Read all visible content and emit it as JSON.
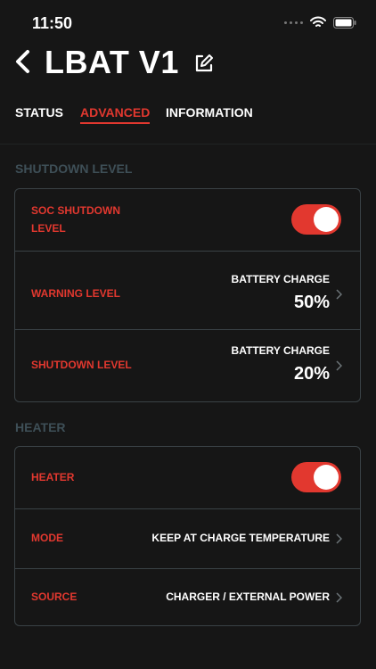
{
  "status_bar": {
    "time": "11:50"
  },
  "header": {
    "title": "LBAT V1"
  },
  "tabs": [
    {
      "label": "STATUS",
      "active": false
    },
    {
      "label": "ADVANCED",
      "active": true
    },
    {
      "label": "INFORMATION",
      "active": false
    }
  ],
  "shutdown": {
    "section_title": "SHUTDOWN LEVEL",
    "soc": {
      "label_line1": "SOC SHUTDOWN",
      "label_line2": "LEVEL",
      "enabled": true
    },
    "warning": {
      "label": "WARNING LEVEL",
      "caption": "BATTERY CHARGE",
      "value": "50%"
    },
    "shutdown_level": {
      "label": "SHUTDOWN LEVEL",
      "caption": "BATTERY CHARGE",
      "value": "20%"
    }
  },
  "heater": {
    "section_title": "HEATER",
    "heater_toggle": {
      "label": "HEATER",
      "enabled": true
    },
    "mode": {
      "label": "MODE",
      "value": "KEEP AT CHARGE TEMPERATURE"
    },
    "source": {
      "label": "SOURCE",
      "value": "CHARGER / EXTERNAL POWER"
    }
  },
  "colors": {
    "accent": "#e2382f",
    "background": "#161616",
    "border": "#3a4246",
    "section_title": "#3e4f57"
  }
}
